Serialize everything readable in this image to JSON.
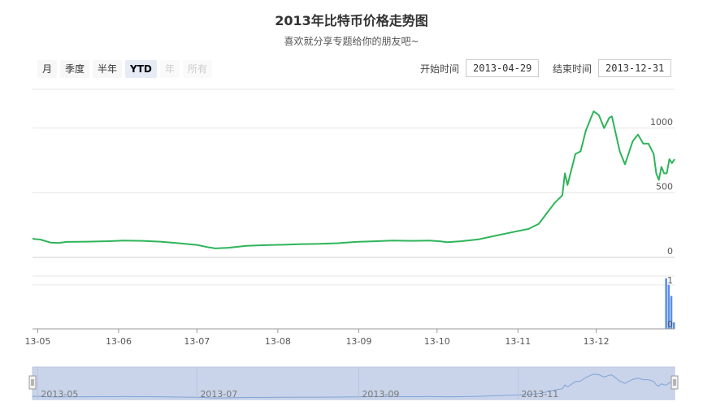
{
  "title": "2013年比特币价格走势图",
  "subtitle": "喜欢就分享专题给你的朋友吧~",
  "range_selector": {
    "buttons": [
      {
        "label": "月",
        "state": "normal"
      },
      {
        "label": "季度",
        "state": "normal"
      },
      {
        "label": "半年",
        "state": "normal"
      },
      {
        "label": "YTD",
        "state": "active"
      },
      {
        "label": "年",
        "state": "disabled"
      },
      {
        "label": "所有",
        "state": "disabled"
      }
    ],
    "start_label": "开始时间",
    "start_value": "2013-04-29",
    "end_label": "结束时间",
    "end_value": "2013-12-31"
  },
  "colors": {
    "price_line": "#2fb45a",
    "volume_bar": "#5b8ee6",
    "navigator_fill": "#c9d4ea",
    "navigator_line": "#7fa3d8"
  },
  "chart_data": {
    "type": "line",
    "x_domain": [
      "2013-04-29",
      "2013-12-31"
    ],
    "x_ticks": [
      {
        "date": "2013-05-01",
        "label": "13-05"
      },
      {
        "date": "2013-06-01",
        "label": "13-06"
      },
      {
        "date": "2013-07-01",
        "label": "13-07"
      },
      {
        "date": "2013-08-01",
        "label": "13-08"
      },
      {
        "date": "2013-09-01",
        "label": "13-09"
      },
      {
        "date": "2013-10-01",
        "label": "13-10"
      },
      {
        "date": "2013-11-01",
        "label": "13-11"
      },
      {
        "date": "2013-12-01",
        "label": "13-12"
      }
    ],
    "price": {
      "y_axis": {
        "min": 0,
        "max": 1300,
        "ticks": [
          0,
          500,
          1000
        ],
        "position": "right"
      },
      "points": [
        [
          "2013-04-29",
          144
        ],
        [
          "2013-05-02",
          138
        ],
        [
          "2013-05-06",
          114
        ],
        [
          "2013-05-09",
          112
        ],
        [
          "2013-05-12",
          120
        ],
        [
          "2013-05-20",
          122
        ],
        [
          "2013-05-27",
          125
        ],
        [
          "2013-06-03",
          130
        ],
        [
          "2013-06-10",
          128
        ],
        [
          "2013-06-17",
          122
        ],
        [
          "2013-06-24",
          110
        ],
        [
          "2013-07-01",
          97
        ],
        [
          "2013-07-05",
          80
        ],
        [
          "2013-07-08",
          70
        ],
        [
          "2013-07-13",
          75
        ],
        [
          "2013-07-20",
          90
        ],
        [
          "2013-07-27",
          95
        ],
        [
          "2013-08-03",
          98
        ],
        [
          "2013-08-10",
          103
        ],
        [
          "2013-08-17",
          105
        ],
        [
          "2013-08-24",
          110
        ],
        [
          "2013-08-31",
          120
        ],
        [
          "2013-09-07",
          125
        ],
        [
          "2013-09-14",
          130
        ],
        [
          "2013-09-21",
          128
        ],
        [
          "2013-09-28",
          130
        ],
        [
          "2013-10-02",
          125
        ],
        [
          "2013-10-05",
          118
        ],
        [
          "2013-10-10",
          125
        ],
        [
          "2013-10-17",
          140
        ],
        [
          "2013-10-24",
          170
        ],
        [
          "2013-10-31",
          200
        ],
        [
          "2013-11-05",
          220
        ],
        [
          "2013-11-09",
          260
        ],
        [
          "2013-11-12",
          340
        ],
        [
          "2013-11-15",
          420
        ],
        [
          "2013-11-18",
          480
        ],
        [
          "2013-11-19",
          650
        ],
        [
          "2013-11-20",
          560
        ],
        [
          "2013-11-23",
          800
        ],
        [
          "2013-11-25",
          820
        ],
        [
          "2013-11-27",
          980
        ],
        [
          "2013-11-29",
          1080
        ],
        [
          "2013-11-30",
          1130
        ],
        [
          "2013-12-02",
          1100
        ],
        [
          "2013-12-04",
          1000
        ],
        [
          "2013-12-06",
          1080
        ],
        [
          "2013-12-07",
          1090
        ],
        [
          "2013-12-10",
          820
        ],
        [
          "2013-12-12",
          720
        ],
        [
          "2013-12-15",
          900
        ],
        [
          "2013-12-17",
          950
        ],
        [
          "2013-12-19",
          880
        ],
        [
          "2013-12-21",
          880
        ],
        [
          "2013-12-23",
          800
        ],
        [
          "2013-12-24",
          650
        ],
        [
          "2013-12-25",
          600
        ],
        [
          "2013-12-26",
          700
        ],
        [
          "2013-12-27",
          650
        ],
        [
          "2013-12-28",
          650
        ],
        [
          "2013-12-29",
          760
        ],
        [
          "2013-12-30",
          730
        ],
        [
          "2013-12-31",
          760
        ]
      ]
    },
    "volume": {
      "y_axis": {
        "min": 0,
        "max": 1.2,
        "ticks": [
          0,
          1
        ],
        "position": "right"
      },
      "bars": [
        [
          "2013-12-28",
          1.15
        ],
        [
          "2013-12-29",
          1.0
        ],
        [
          "2013-12-30",
          0.75
        ],
        [
          "2013-12-31",
          0.15
        ]
      ]
    },
    "navigator": {
      "ticks": [
        {
          "date": "2013-05-01",
          "label": "2013-05"
        },
        {
          "date": "2013-07-01",
          "label": "2013-07"
        },
        {
          "date": "2013-09-01",
          "label": "2013-09"
        },
        {
          "date": "2013-11-01",
          "label": "2013-11"
        }
      ]
    },
    "grid": true,
    "legend": "none"
  }
}
